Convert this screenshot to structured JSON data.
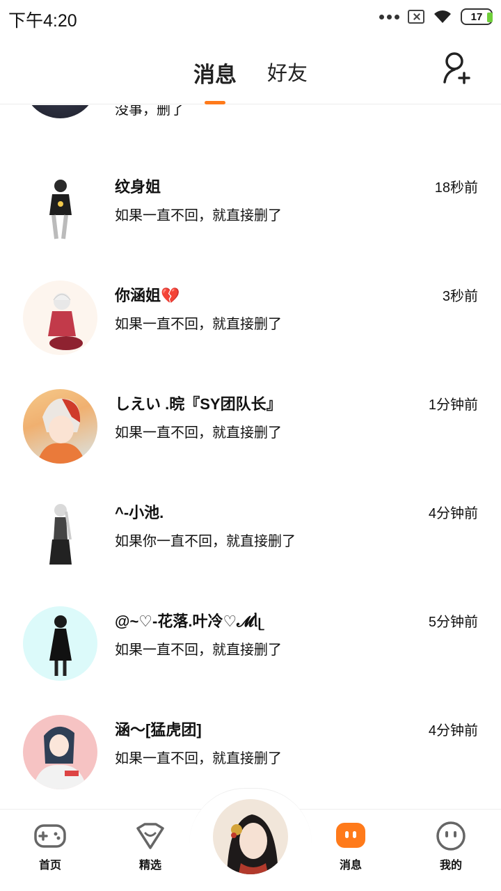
{
  "status_bar": {
    "time": "下午4:20",
    "battery": "17"
  },
  "header": {
    "tab_messages": "消息",
    "tab_friends": "好友"
  },
  "partial_row": {
    "message": "没事，删了"
  },
  "conversations": [
    {
      "name": "纹身姐",
      "time": "18秒前",
      "message": "如果一直不回，就直接删了"
    },
    {
      "name": "你涵姐💔",
      "time": "3秒前",
      "message": "如果一直不回，就直接删了"
    },
    {
      "name": "しえい .晥『SY团队长』",
      "time": "1分钟前",
      "message": "如果一直不回，就直接删了"
    },
    {
      "name": "^-小池.",
      "time": "4分钟前",
      "message": "如果你一直不回，就直接删了"
    },
    {
      "name": "@~♡-花落.叶冷♡𝓜ᥣᥨ",
      "time": "5分钟前",
      "message": "如果一直不回，就直接删了"
    },
    {
      "name": "涵～[猛虎团]",
      "time": "4分钟前",
      "message": "如果一直不回，就直接删了"
    }
  ],
  "bottom_nav": {
    "home": "首页",
    "featured": "精选",
    "messages": "消息",
    "me": "我的"
  },
  "colors": {
    "accent": "#ff7a1a",
    "text": "#111111"
  }
}
